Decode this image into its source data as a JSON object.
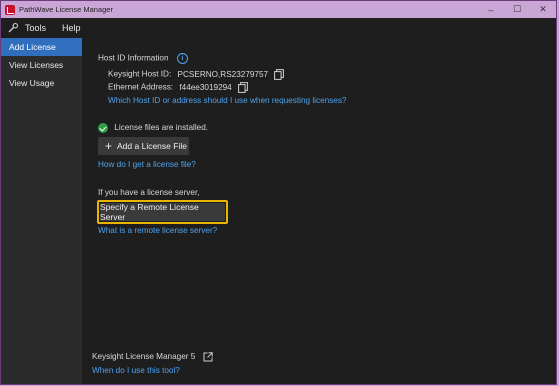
{
  "window": {
    "title": "PathWave License Manager",
    "controls": {
      "minimize": "–",
      "maximize": "☐",
      "close": "✕"
    }
  },
  "menu": {
    "tools": "Tools",
    "help": "Help"
  },
  "sidebar": {
    "items": [
      {
        "label": "Add License",
        "active": true
      },
      {
        "label": "View Licenses",
        "active": false
      },
      {
        "label": "View Usage",
        "active": false
      }
    ]
  },
  "host": {
    "heading": "Host ID Information",
    "keysight_label": "Keysight Host ID:",
    "keysight_value": "PCSERNO,RS23279757",
    "ethernet_label": "Ethernet Address:",
    "ethernet_value": "f44ee3019294",
    "help_link": "Which Host ID or address should I use when requesting licenses?"
  },
  "license_files": {
    "status": "License files are installed.",
    "add_button": "Add a License File",
    "help_link": "How do I get a license file?"
  },
  "server": {
    "intro": "If you have a license server,",
    "button": "Specify a Remote License Server",
    "help_link": "What is a remote license server?"
  },
  "footer": {
    "product": "Keysight License Manager 5",
    "help_link": "When do I use this tool?"
  },
  "colors": {
    "accent": "#2f6fbe",
    "link": "#4ea3f0",
    "highlight": "#e8b500",
    "success": "#2ea043",
    "titlebar": "#c9a6d6"
  },
  "icons": [
    "app-icon",
    "tools-icon",
    "info-icon",
    "copy-icon",
    "check-icon",
    "plus-icon",
    "external-link-icon"
  ]
}
